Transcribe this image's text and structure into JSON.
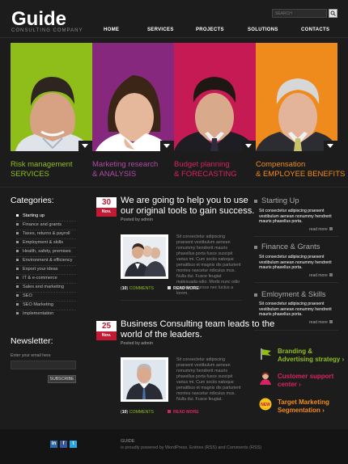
{
  "brand": {
    "logo": "Guide",
    "tagline": "CONSULTING COMPANY"
  },
  "search": {
    "placeholder": "SEARCH"
  },
  "nav": {
    "items": [
      "HOME",
      "SERVICES",
      "PROJECTS",
      "SOLUTIONS",
      "CONTACTS"
    ]
  },
  "banner": {
    "panels": [
      {
        "color": "#8fbe1b",
        "line1": "Risk management",
        "line2": "SERVICES",
        "line1_color": "#8fbe1b",
        "line2_color": "#8fbe1b"
      },
      {
        "color": "#87287f",
        "line1": "Marketing research",
        "line2": "& ANALYSIS",
        "line1_color": "#b24aa9",
        "line2_color": "#b24aa9"
      },
      {
        "color": "#c51a53",
        "line1": "Budget planning",
        "line2": "& FORECASTING",
        "line1_color": "#d8245e",
        "line2_color": "#d8245e"
      },
      {
        "color": "#ef8a1c",
        "line1": "Compensation",
        "line2": "& EMPLOYEE BENEFITS",
        "line1_color": "#f08b1e",
        "line2_color": "#f08b1e"
      }
    ]
  },
  "categories": {
    "title": "Categories:",
    "items": [
      "Starting up",
      "Finance and grants",
      "Taxes, returns & payroll",
      "Employment & skills",
      "Health, safety, premises",
      "Environment & efficiency",
      "Export your ideas",
      "IT & e-commerce",
      "Sales and marketing",
      "SEO",
      "SEO Marketing",
      "Implementation"
    ]
  },
  "newsletter": {
    "title": "Newsletter:",
    "label": "Enter your email here",
    "button": "SUBSCRIBE"
  },
  "posts": [
    {
      "day": "30",
      "month": "Nov.",
      "title_lines": [
        "We are going to help you to use",
        "our original tools to gain success."
      ],
      "posted": "Posted by admin",
      "excerpt": "Sit consectetur adipiscing praesent vestibulum aenean nonummy hendrerit mauris phasellus porta fusce suscipit varius mi. Cum sociis natoque penatibus et magnis dis parturient montes nascetur ridiculus mus. Nulla dui. Fusce feugiat malesuada odio. Morbi nunc odio gravida at cursus nec luctus a lorem.",
      "comments_count": "10",
      "comments_label": "COMMENTS",
      "read_more": "READ MORE"
    },
    {
      "day": "25",
      "month": "Nov.",
      "title_lines": [
        "Business Consulting team leads to the",
        "world of the leaders."
      ],
      "posted": "Posted by admin",
      "excerpt": "Sit consectetur adipiscing praesent vestibulum aenean nonummy hendrerit mauris phasellus porta fusce suscipit varius mi. Cum sociis natoque penatibus et magnis dis parturient montes nascetur ridiculus mus. Nulla dui. Fusce feugiat.",
      "comments_count": "10",
      "comments_label": "COMMENTS",
      "read_more": "READ MORE"
    }
  ],
  "right": {
    "sections": [
      {
        "title": "Starting Up",
        "text": "Sit consectetur adipiscing praesent vestibulum aenean nonummy hendrerit mauris phasellus porta.",
        "more": "read more"
      },
      {
        "title": "Finance & Grants",
        "text": "Sit consectetur adipiscing praesent vestibulum aenean nonummy hendrerit mauris phasellus porta.",
        "more": "read more"
      },
      {
        "title": "Emloyment & Skills",
        "text": "Sit consectetur adipiscing praesent vestibulum aenean nonummy hendrerit mauris phasellus porta.",
        "more": "read more"
      }
    ],
    "ads": [
      {
        "line1": "Branding &",
        "line2": "Advertising strategy",
        "color": "#8fbe1b",
        "icon": "flag-icon"
      },
      {
        "line1": "Customer support",
        "line2": "center",
        "color": "#d8245e",
        "icon": "support-person-icon"
      },
      {
        "line1": "Target Marketing",
        "line2": "Segmentation",
        "color": "#f08b1e",
        "icon": "new-badge-icon",
        "badge": "NEW"
      }
    ]
  },
  "footer": {
    "brand": "GUIDE",
    "credit": "is proudly powered by WordPress. Entries (RSS) and Comments (RSS)",
    "social": [
      "in",
      "f",
      "t"
    ]
  },
  "colors": {
    "green": "#8fbe1b",
    "purple": "#87287f",
    "red": "#c51a53",
    "orange": "#ef8a1c",
    "date_red": "#c21a34"
  }
}
